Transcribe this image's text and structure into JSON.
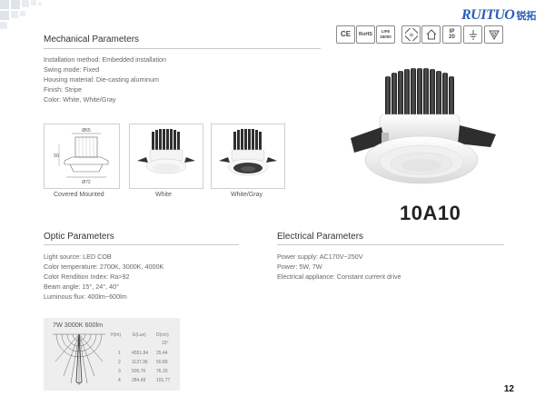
{
  "brand": {
    "name": "RUITUO",
    "chinese": "锐拓"
  },
  "certifications": [
    {
      "icon": "ce-mark-icon",
      "label": "CE"
    },
    {
      "icon": "rohs-mark-icon",
      "label": "RoHS"
    },
    {
      "icon": "life-hours-icon",
      "label": "LIFE 25000"
    },
    {
      "icon": "safety-class-icon",
      "label": ""
    },
    {
      "icon": "house-indoor-icon",
      "label": ""
    },
    {
      "icon": "ip-rating-icon",
      "label": "IP 20"
    },
    {
      "icon": "ground-symbol-icon",
      "label": ""
    },
    {
      "icon": "triangle-warning-icon",
      "label": ""
    }
  ],
  "mechanical": {
    "heading": "Mechanical Parameters",
    "lines": [
      "Installation method: Embedded installation",
      "Swing mode: Fixed",
      "Housing material: Die-casting aluminum",
      "Finish: Stripe",
      "Color: White,  White/Gray"
    ]
  },
  "drawing": {
    "top_dim": "Ø65",
    "bottom_dim": "Ø72",
    "side_dim": "50"
  },
  "thumbnails": [
    {
      "caption": "Covered Mounted"
    },
    {
      "caption": "White"
    },
    {
      "caption": "White/Gray"
    }
  ],
  "model": "10A10",
  "optic": {
    "heading": "Optic Parameters",
    "lines": [
      "Light source: LED COB",
      "Color temperature: 2700K,  3000K,  4000K",
      "Color Rendition Index: Ra>92",
      "Beam angle: 15°, 24°, 40°",
      "Luminous flux: 400lm~600lm"
    ]
  },
  "electrical": {
    "heading": "Electrical Parameters",
    "lines": [
      "Power supply: AC170V~250V",
      "Power: 5W, 7W",
      "Electrical appliance: Constant current drive"
    ]
  },
  "photometric": {
    "title": "7W  3000K  600lm",
    "headers": [
      "H(m)",
      "E(Lux)",
      "D(cm)"
    ],
    "angle": "15°",
    "rows": [
      [
        "1",
        "4551.84",
        "25.44"
      ],
      [
        "2",
        "1137.96",
        "50.89"
      ],
      [
        "3",
        "505.76",
        "76.33"
      ],
      [
        "4",
        "284.49",
        "101.77"
      ]
    ]
  },
  "page_number": "12",
  "colors": {
    "accent_blue": "#2a5bb5",
    "heatsink": "#2d2d2d",
    "body_white": "#f2f2f2"
  }
}
